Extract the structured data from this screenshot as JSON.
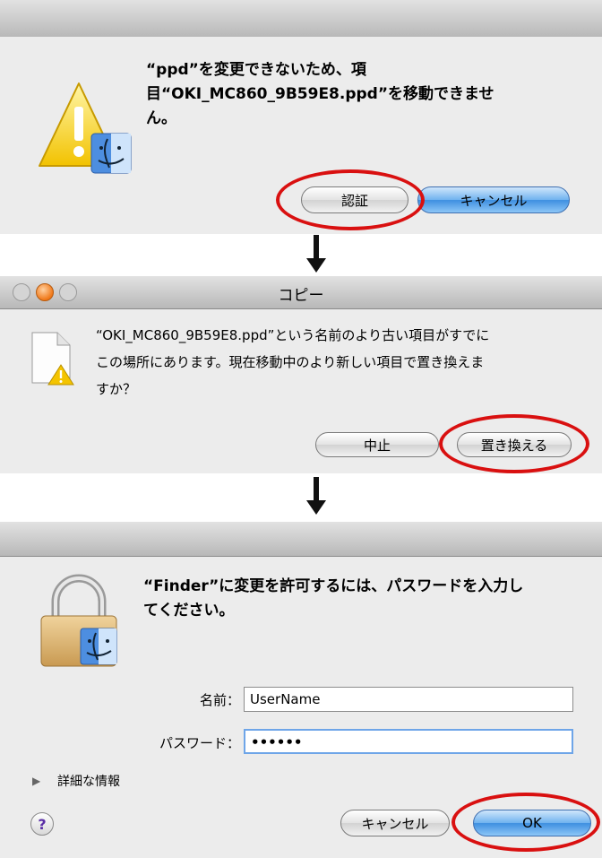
{
  "dialog1": {
    "message_line1": "“ppd”を変更できないため、項",
    "message_line2": "目“OKI_MC860_9B59E8.ppd”を移動できませ",
    "message_line3": "ん。",
    "authenticate_label": "認証",
    "cancel_label": "キャンセル"
  },
  "dialog2": {
    "window_title": "コピー",
    "message_line1": "“OKI_MC860_9B59E8.ppd”という名前のより古い項目がすでに",
    "message_line2": "この場所にあります。現在移動中のより新しい項目で置き換えま",
    "message_line3": "すか？",
    "stop_label": "中止",
    "replace_label": "置き換える"
  },
  "dialog3": {
    "message_line1": "“Finder”に変更を許可するには、パスワードを入力し",
    "message_line2": "てください。",
    "name_label": "名前：",
    "name_value": "UserName",
    "password_label": "パスワード：",
    "password_value": "••••••",
    "details_label": "詳細な情報",
    "help_label": "?",
    "cancel_label": "キャンセル",
    "ok_label": "OK"
  },
  "colors": {
    "highlight_ring": "#d91010",
    "default_button": "#3e8fe0",
    "dialog_background": "#ececec"
  }
}
